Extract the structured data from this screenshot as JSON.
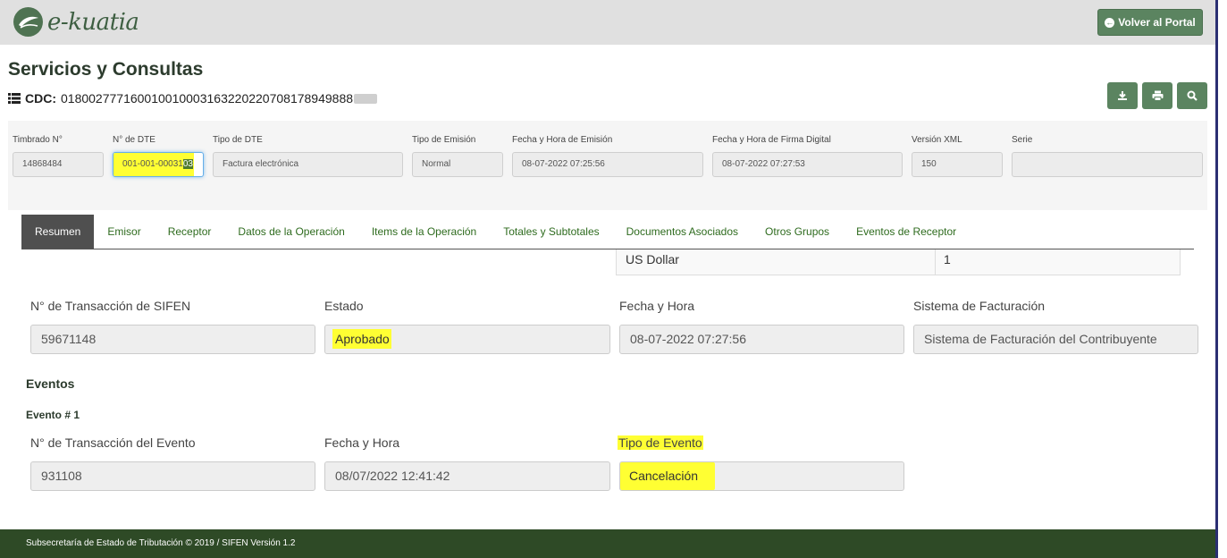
{
  "header": {
    "brand": "e-kuatia",
    "portal_button": "Volver al Portal"
  },
  "page": {
    "title": "Servicios y Consultas",
    "cdc_label": "CDC:",
    "cdc_value": "018002777160010010003163220220708178949888"
  },
  "toolbar": {
    "download_icon": "download-icon",
    "print_icon": "print-icon",
    "search_icon": "search-icon"
  },
  "meta": {
    "timbrado": {
      "label": "Timbrado N°",
      "value": "14868484"
    },
    "nro_dte": {
      "label": "N° de DTE",
      "value": "001-001-00031",
      "value_tail": "03"
    },
    "tipo_dte": {
      "label": "Tipo de DTE",
      "value": "Factura electrónica"
    },
    "tipo_emision": {
      "label": "Tipo de Emisión",
      "value": "Normal"
    },
    "fecha_emision": {
      "label": "Fecha y Hora de Emisión",
      "value": "08-07-2022 07:25:56"
    },
    "fecha_firma": {
      "label": "Fecha y Hora de Firma Digital",
      "value": "08-07-2022 07:27:53"
    },
    "version_xml": {
      "label": "Versión XML",
      "value": "150"
    },
    "serie": {
      "label": "Serie",
      "value": ""
    }
  },
  "tabs": [
    {
      "label": "Resumen",
      "active": true
    },
    {
      "label": "Emisor"
    },
    {
      "label": "Receptor"
    },
    {
      "label": "Datos de la Operación"
    },
    {
      "label": "Items de la Operación"
    },
    {
      "label": "Totales y Subtotales"
    },
    {
      "label": "Documentos Asociados"
    },
    {
      "label": "Otros Grupos"
    },
    {
      "label": "Eventos de Receptor"
    }
  ],
  "currency_row": {
    "currency": "US Dollar",
    "rate": "1"
  },
  "transaction": {
    "sifen": {
      "label": "N° de Transacción de SIFEN",
      "value": "59671148"
    },
    "estado": {
      "label": "Estado",
      "value": "Aprobado"
    },
    "fecha": {
      "label": "Fecha y Hora",
      "value": "08-07-2022 07:27:56"
    },
    "sistema": {
      "label": "Sistema de Facturación",
      "value": "Sistema de Facturación del Contribuyente"
    }
  },
  "events": {
    "title": "Eventos",
    "event_title": "Evento # 1",
    "nro": {
      "label": "N° de Transacción del Evento",
      "value": "931108"
    },
    "fecha": {
      "label": "Fecha y Hora",
      "value": "08/07/2022 12:41:42"
    },
    "tipo": {
      "label": "Tipo de Evento",
      "value": "Cancelación"
    }
  },
  "footer": {
    "text": "Subsecretaría de Estado de Tributación © 2019 / SIFEN Versión 1.2"
  },
  "colors": {
    "accent": "#5b8460",
    "footer": "#2e4a26",
    "highlight": "#ffff33",
    "tab_active": "#4f4f4f"
  }
}
